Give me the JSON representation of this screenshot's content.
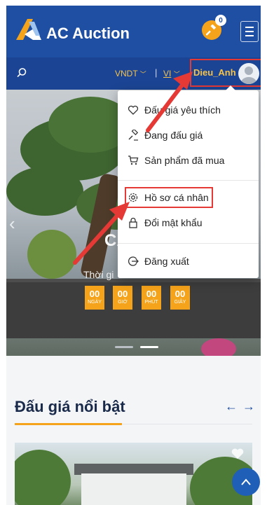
{
  "header": {
    "brand": "AC Auction",
    "notification_count": "0",
    "icons": {
      "logo": "ac-logo",
      "gavel": "gavel-icon",
      "menu": "hamburger-icon"
    }
  },
  "navbar": {
    "currency": "VNDT",
    "separator": "|",
    "language": "VI",
    "username": "Dieu_Anh"
  },
  "dropdown": {
    "items": [
      {
        "label": "Đấu giá yêu thích",
        "icon": "heart-icon"
      },
      {
        "label": "Đang đấu giá",
        "icon": "gavel-icon"
      },
      {
        "label": "Sản phẩm đã mua",
        "icon": "cart-icon"
      },
      {
        "label": "Hồ sơ cá nhân",
        "icon": "gear-icon"
      },
      {
        "label": "Đổi mật khẩu",
        "icon": "lock-icon"
      },
      {
        "label": "Đăng xuất",
        "icon": "logout-icon"
      }
    ]
  },
  "hero": {
    "title": "CÂY",
    "time_label": "Thời gi",
    "countdown": [
      {
        "value": "00",
        "unit": "NGÀY"
      },
      {
        "value": "00",
        "unit": "GIỜ"
      },
      {
        "value": "00",
        "unit": "PHÚT"
      },
      {
        "value": "00",
        "unit": "GIÂY"
      }
    ],
    "prev_arrow": "‹"
  },
  "featured": {
    "title": "Đấu giá nổi bật",
    "prev": "←",
    "next": "→"
  },
  "colors": {
    "primary": "#1f4fa2",
    "accent": "#f5a31a",
    "highlight": "#e53935"
  }
}
